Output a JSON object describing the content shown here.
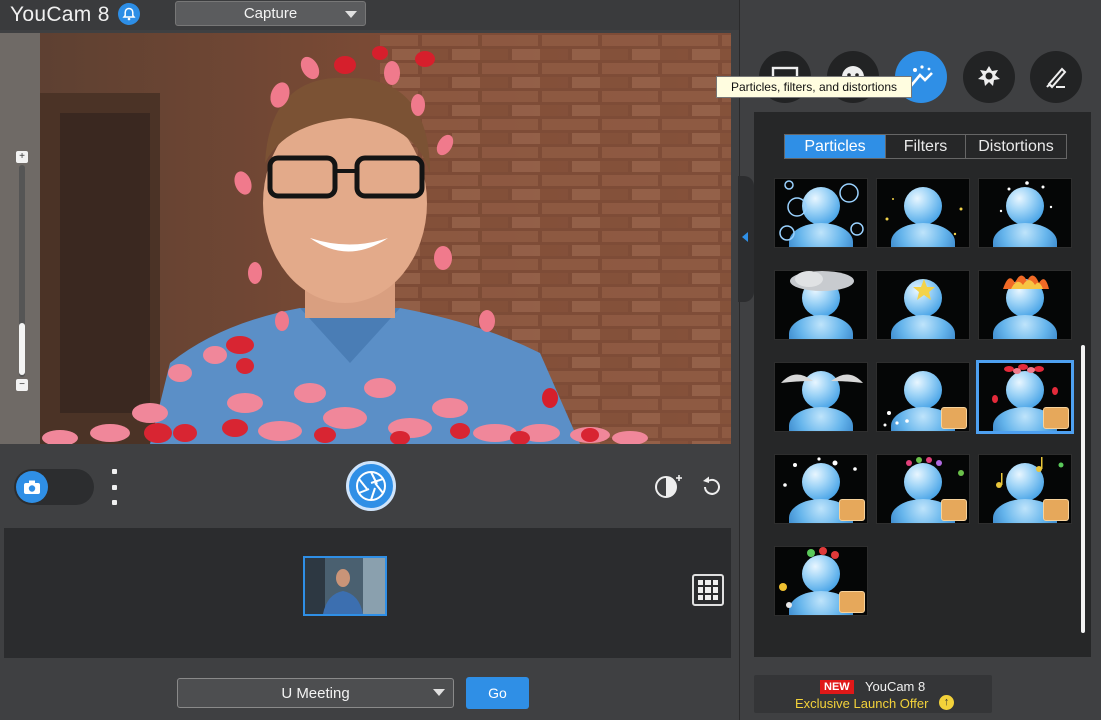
{
  "app": {
    "title": "YouCam 8"
  },
  "header": {
    "mode_value": "Capture"
  },
  "tooltip": {
    "text": "Particles, filters, and distortions"
  },
  "tabs": [
    {
      "label": "Particles",
      "active": true
    },
    {
      "label": "Filters",
      "active": false
    },
    {
      "label": "Distortions",
      "active": false
    }
  ],
  "effects": [
    {
      "name": "bubbles",
      "premium": false,
      "selected": false
    },
    {
      "name": "glitter",
      "premium": false,
      "selected": false
    },
    {
      "name": "sparkle",
      "premium": false,
      "selected": false
    },
    {
      "name": "storm-cloud",
      "premium": false,
      "selected": false
    },
    {
      "name": "star-dizzy",
      "premium": false,
      "selected": false
    },
    {
      "name": "fire",
      "premium": false,
      "selected": false
    },
    {
      "name": "angel-wings",
      "premium": false,
      "selected": false
    },
    {
      "name": "snow",
      "premium": true,
      "selected": false
    },
    {
      "name": "rose-petals",
      "premium": true,
      "selected": true
    },
    {
      "name": "snowflakes",
      "premium": true,
      "selected": false
    },
    {
      "name": "flower-crown",
      "premium": true,
      "selected": false
    },
    {
      "name": "music-notes",
      "premium": true,
      "selected": false
    },
    {
      "name": "balloons",
      "premium": true,
      "selected": false
    }
  ],
  "footer": {
    "meeting_value": "U Meeting",
    "go_label": "Go"
  },
  "promo": {
    "badge": "NEW",
    "name": "YouCam 8",
    "offer": "Exclusive Launch Offer"
  },
  "colors": {
    "accent": "#2f8fe6",
    "background": "#3f4042",
    "panel": "#262728"
  }
}
